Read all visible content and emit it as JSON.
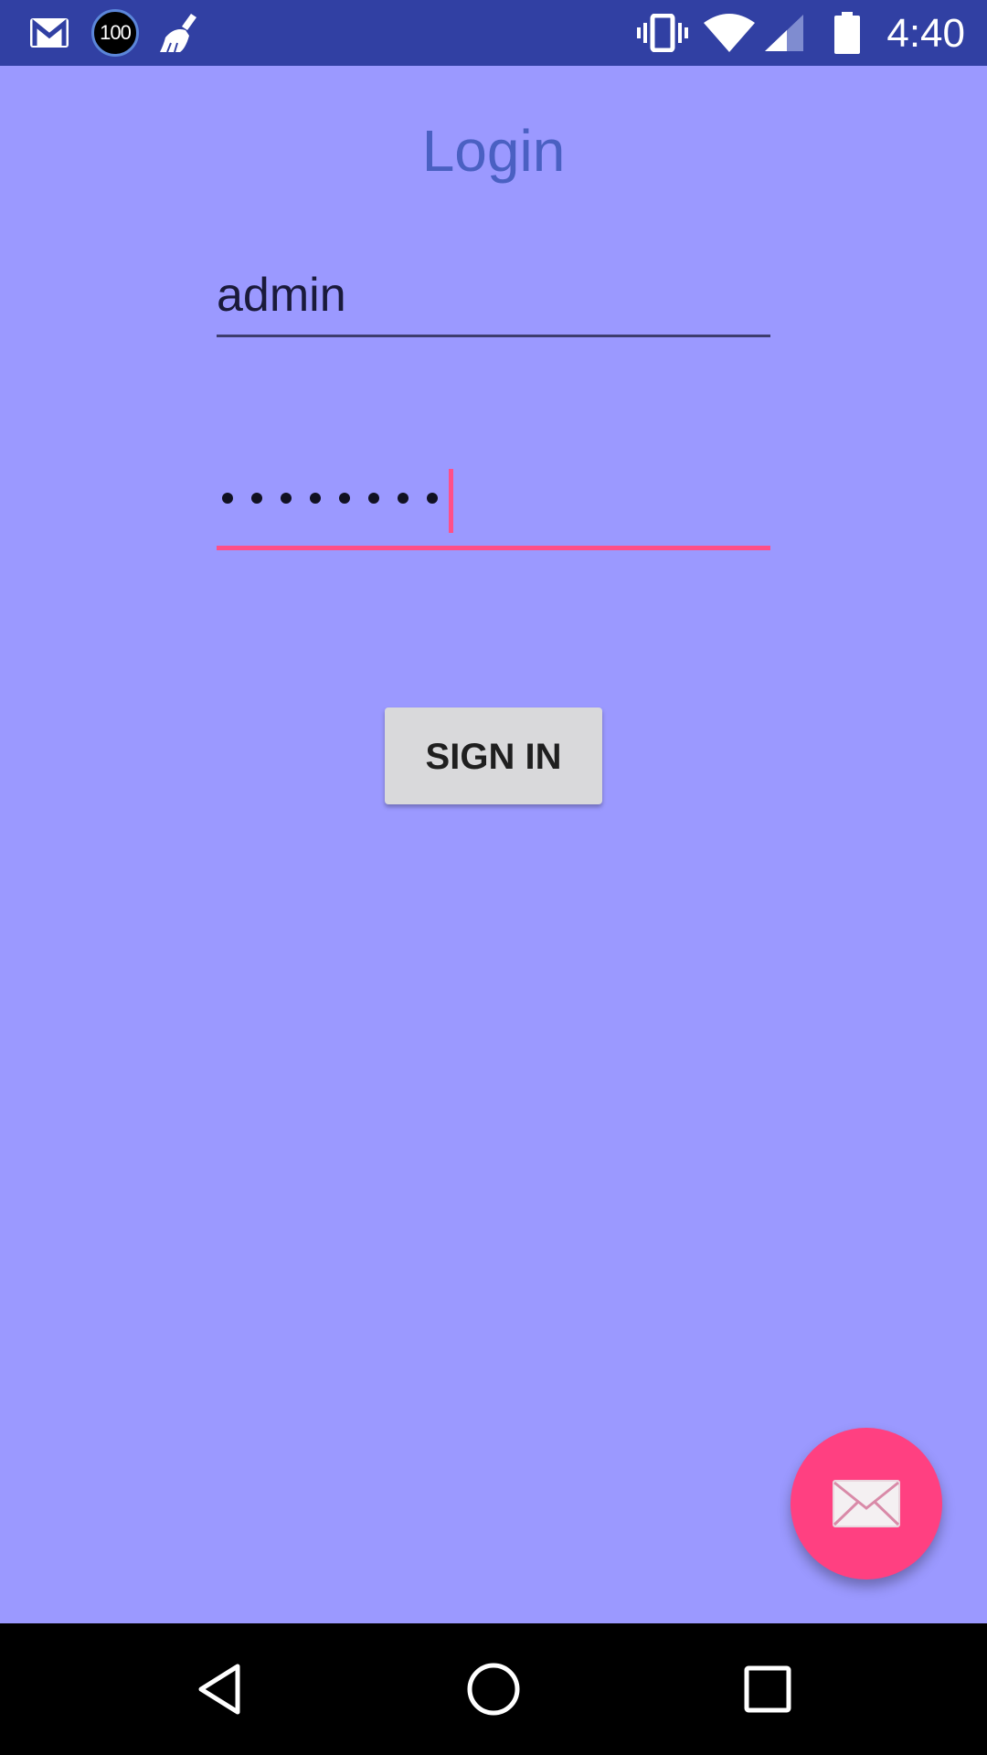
{
  "status_bar": {
    "time": "4:40",
    "badge_text": "100",
    "icons": [
      "gmail-icon",
      "badge-100-icon",
      "cleaner-broom-icon",
      "vibrate-icon",
      "wifi-icon",
      "cell-signal-icon",
      "battery-icon"
    ]
  },
  "login": {
    "title": "Login",
    "username_value": "admin",
    "password_masked_length": 8,
    "sign_in_label": "SIGN IN"
  },
  "fab": {
    "icon": "mail-icon"
  },
  "nav_bar": {
    "icons": [
      "back-icon",
      "home-icon",
      "recents-icon"
    ]
  },
  "colors": {
    "background": "#9b99ff",
    "status_bar": "#3140a3",
    "title": "#4a60c2",
    "accent": "#ff4081",
    "button": "#d9d9db"
  }
}
